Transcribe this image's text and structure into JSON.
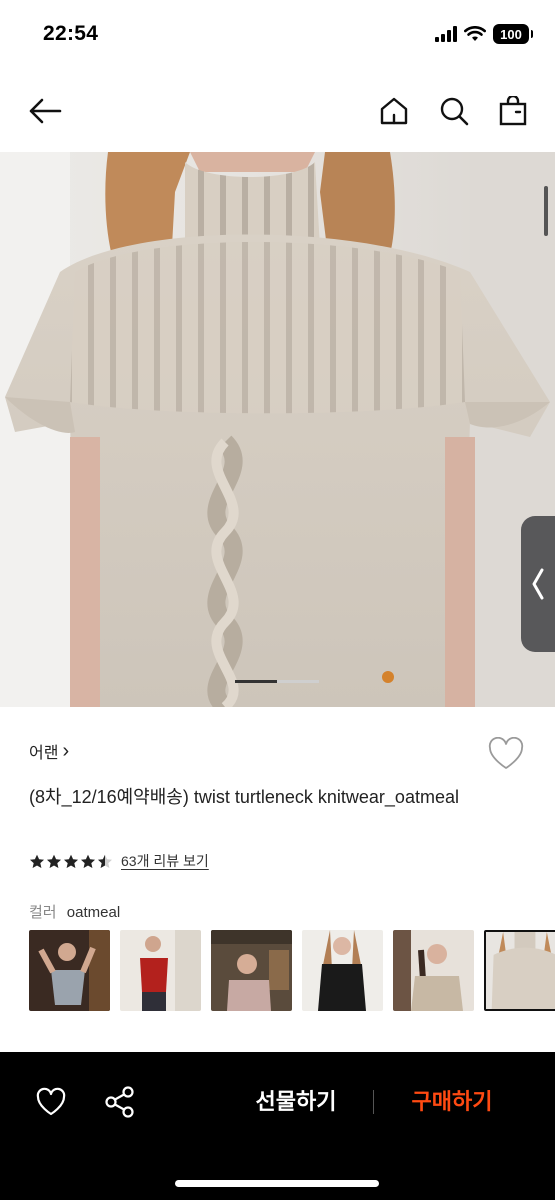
{
  "status_bar": {
    "time": "22:54",
    "battery": "100",
    "icons": [
      "signal-icon",
      "wifi-icon",
      "battery-icon"
    ]
  },
  "nav": {
    "icons": [
      "back-arrow-icon",
      "home-icon",
      "search-icon",
      "shopping-bag-icon"
    ]
  },
  "product_image": {
    "slide_count": 2,
    "active_slide": 1,
    "colors": {
      "active_indicator": "#333333",
      "inactive_indicator": "#cfcfcf"
    }
  },
  "product": {
    "brand": "어랜",
    "brand_chevron": "›",
    "title": "(8차_12/16예약배송) twist turtleneck knitwear_oatmeal",
    "rating": 4.5,
    "review_link": "63개 리뷰 보기",
    "color_label": "컬러",
    "color_value": "oatmeal"
  },
  "color_options": [
    {
      "name": "option-1",
      "selected": false
    },
    {
      "name": "option-2",
      "selected": false
    },
    {
      "name": "option-3",
      "selected": false
    },
    {
      "name": "option-4",
      "selected": false
    },
    {
      "name": "option-5",
      "selected": false
    },
    {
      "name": "option-6",
      "selected": true
    }
  ],
  "bottom_bar": {
    "gift_label": "선물하기",
    "buy_label": "구매하기",
    "icons": [
      "heart-icon",
      "share-icon"
    ],
    "colors": {
      "background": "#000000",
      "buy_accent": "#ff4a12"
    }
  }
}
